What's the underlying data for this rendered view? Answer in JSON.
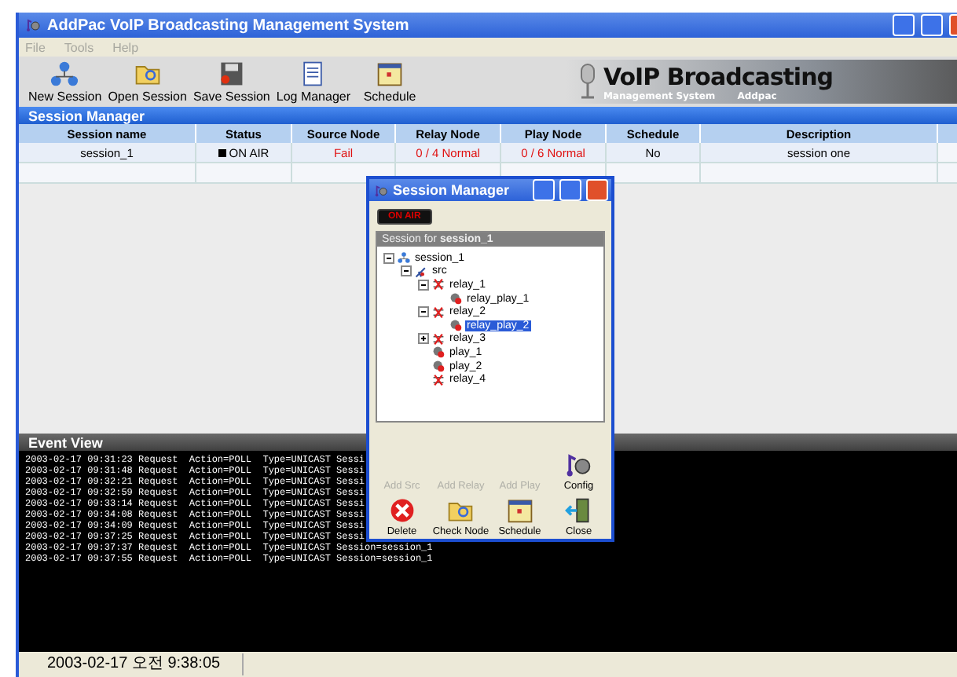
{
  "window": {
    "title": "AddPac VoIP Broadcasting Management System"
  },
  "menu": [
    {
      "label": "File",
      "disabled": true
    },
    {
      "label": "Tools",
      "disabled": true
    },
    {
      "label": "Help",
      "disabled": true
    }
  ],
  "toolbar": [
    {
      "label": "New Session",
      "kind": "network"
    },
    {
      "label": "Open Session",
      "kind": "folder"
    },
    {
      "label": "Save Session",
      "kind": "save"
    },
    {
      "label": "Log Manager",
      "kind": "log"
    },
    {
      "label": "Schedule",
      "kind": "calendar"
    }
  ],
  "banner": {
    "title": "VoIP Broadcasting",
    "subtitle": "Management System",
    "brand": "Addpac"
  },
  "session_manager": {
    "title": "Session Manager",
    "columns": [
      "Session name",
      "Status",
      "Source Node",
      "Relay Node",
      "Play Node",
      "Schedule",
      "Description"
    ],
    "rows": [
      {
        "cells": [
          {
            "text": "session_1",
            "alert": false
          },
          {
            "text": "ON AIR",
            "alert": false,
            "kind": "status"
          },
          {
            "text": "Fail",
            "alert": true
          },
          {
            "text": "0 / 4 Normal",
            "alert": true
          },
          {
            "text": "0 / 6 Normal",
            "alert": true
          },
          {
            "text": "No",
            "alert": false
          },
          {
            "text": "session one",
            "alert": false
          }
        ]
      }
    ]
  },
  "event_view": {
    "title": "Event View",
    "lines": [
      "2003-02-17 09:31:23 Request  Action=POLL  Type=UNICAST Sessi",
      "2003-02-17 09:31:48 Request  Action=POLL  Type=UNICAST Sessi",
      "2003-02-17 09:32:21 Request  Action=POLL  Type=UNICAST Sessi",
      "2003-02-17 09:32:59 Request  Action=POLL  Type=UNICAST Sessi",
      "2003-02-17 09:33:14 Request  Action=POLL  Type=UNICAST Sessi",
      "2003-02-17 09:34:08 Request  Action=POLL  Type=UNICAST Sessi",
      "2003-02-17 09:34:09 Request  Action=POLL  Type=UNICAST Sessi",
      "2003-02-17 09:37:25 Request  Action=POLL  Type=UNICAST Sessi",
      "2003-02-17 09:37:37 Request  Action=POLL  Type=UNICAST Session=session_1",
      "2003-02-17 09:37:55 Request  Action=POLL  Type=UNICAST Session=session_1"
    ]
  },
  "status_bar": {
    "datetime": "2003-02-17 오전 9:38:05"
  },
  "dialog": {
    "title": "Session Manager",
    "badge": "ON AIR",
    "group_label": "Session for ",
    "group_session": "session_1",
    "tree": [
      {
        "label": "session_1",
        "kind": "network",
        "expanded": true,
        "selected": false,
        "children": [
          {
            "label": "src",
            "kind": "src",
            "expanded": true,
            "selected": false,
            "children": [
              {
                "label": "relay_1",
                "kind": "relay",
                "expanded": true,
                "selected": false,
                "children": [
                  {
                    "label": "relay_play_1",
                    "kind": "play",
                    "selected": false
                  }
                ]
              },
              {
                "label": "relay_2",
                "kind": "relay",
                "expanded": true,
                "selected": false,
                "children": [
                  {
                    "label": "relay_play_2",
                    "kind": "play",
                    "selected": true
                  }
                ]
              },
              {
                "label": "relay_3",
                "kind": "relay",
                "expanded": false,
                "selected": false
              },
              {
                "label": "play_1",
                "kind": "play",
                "selected": false
              },
              {
                "label": "play_2",
                "kind": "play",
                "selected": false
              },
              {
                "label": "relay_4",
                "kind": "relay",
                "selected": false
              }
            ]
          }
        ]
      }
    ],
    "top_buttons": [
      {
        "label": "Add Src",
        "kind": "none",
        "disabled": true
      },
      {
        "label": "Add Relay",
        "kind": "none",
        "disabled": true
      },
      {
        "label": "Add Play",
        "kind": "none",
        "disabled": true
      },
      {
        "label": "Config",
        "kind": "speaker",
        "disabled": false
      }
    ],
    "bottom_buttons": [
      {
        "label": "Delete",
        "kind": "delete",
        "disabled": false
      },
      {
        "label": "Check Node",
        "kind": "folder",
        "disabled": false
      },
      {
        "label": "Schedule",
        "kind": "calendar",
        "disabled": false
      },
      {
        "label": "Close",
        "kind": "door",
        "disabled": false
      }
    ]
  }
}
